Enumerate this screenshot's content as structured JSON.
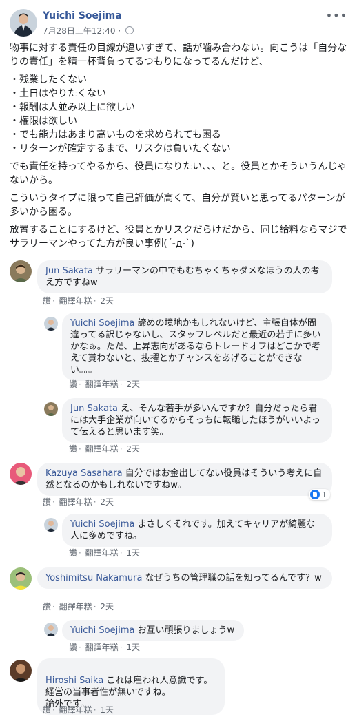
{
  "post": {
    "author": "Yuichi Soejima",
    "timestamp": "7月28日上午12:40",
    "privacy_separator": "·",
    "more_label": "•••",
    "paragraphs": [
      "物事に対する責任の目線が違いすぎて、話が噛み合わない。向こうは「自分なりの責任」を精一杯背負ってるつもりになってるんだけど、",
      "・残業したくない\n・土日はやりたくない\n・報酬は人並み以上に欲しい\n・権限は欲しい\n・でも能力はあまり高いものを求められても困る\n・リターンが確定するまで、リスクは負いたくない",
      "でも責任を持ってやるから、役員になりたい、、、と。役員とかそういうんじゃないから。",
      "こういうタイプに限って自己評価が高くて、自分が賢いと思ってるパターンが多いから困る。",
      "放置することにするけど、役員とかリスクだらけだから、同じ給料ならマジでサラリーマンやってた方が良い事例(´-д-`)"
    ]
  },
  "comments": [
    {
      "name": "Jun Sakata",
      "text": "サラリーマンの中でもむちゃくちゃダメなほうの人の考え方ですねw",
      "like": "讚",
      "translate": "翻譯年糕",
      "time": "2天"
    },
    {
      "name": "Yuichi Soejima",
      "text": "諦めの境地かもしれないけど、主張自体が間違ってる訳じゃないし、スタッフレベルだと最近の若手に多いかなぁ。ただ、上昇志向があるならトレードオフはどこかで考えて貰わないと、抜擢とかチャンスをあげることができない。。。",
      "like": "讚",
      "translate": "翻譯年糕",
      "time": "2天"
    },
    {
      "name": "Jun Sakata",
      "text": "え、そんな若手が多いんですか？自分だったら君には大手企業が向いてるからそっちに転職したほうがいいよって伝えると思います笑。",
      "like": "讚",
      "translate": "翻譯年糕",
      "time": "2天"
    },
    {
      "name": "Kazuya Sasahara",
      "text": "自分ではお金出してない役員はそういう考えに自然となるのかもしれないですねw。",
      "like": "讚",
      "translate": "翻譯年糕",
      "time": "2天",
      "reactions": "1"
    },
    {
      "name": "Yuichi Soejima",
      "text": "まさしくそれです。加えてキャリアが綺麗な人に多めですね。",
      "like": "讚",
      "translate": "翻譯年糕",
      "time": "1天"
    },
    {
      "name": "Yoshimitsu Nakamura",
      "text": "なぜうちの管理職の話を知ってるんです？w",
      "like": "讚",
      "translate": "翻譯年糕",
      "time": "2天"
    },
    {
      "name": "Yuichi Soejima",
      "text": "お互い頑張りましょうw",
      "like": "讚",
      "translate": "翻譯年糕",
      "time": "1天"
    },
    {
      "name": "Hiroshi Saika",
      "text": "これは雇われ人意識です。\n経営の当事者性が無いですね。\n論外です。",
      "like": "讚",
      "translate": "翻譯年糕",
      "time": "1天"
    }
  ]
}
